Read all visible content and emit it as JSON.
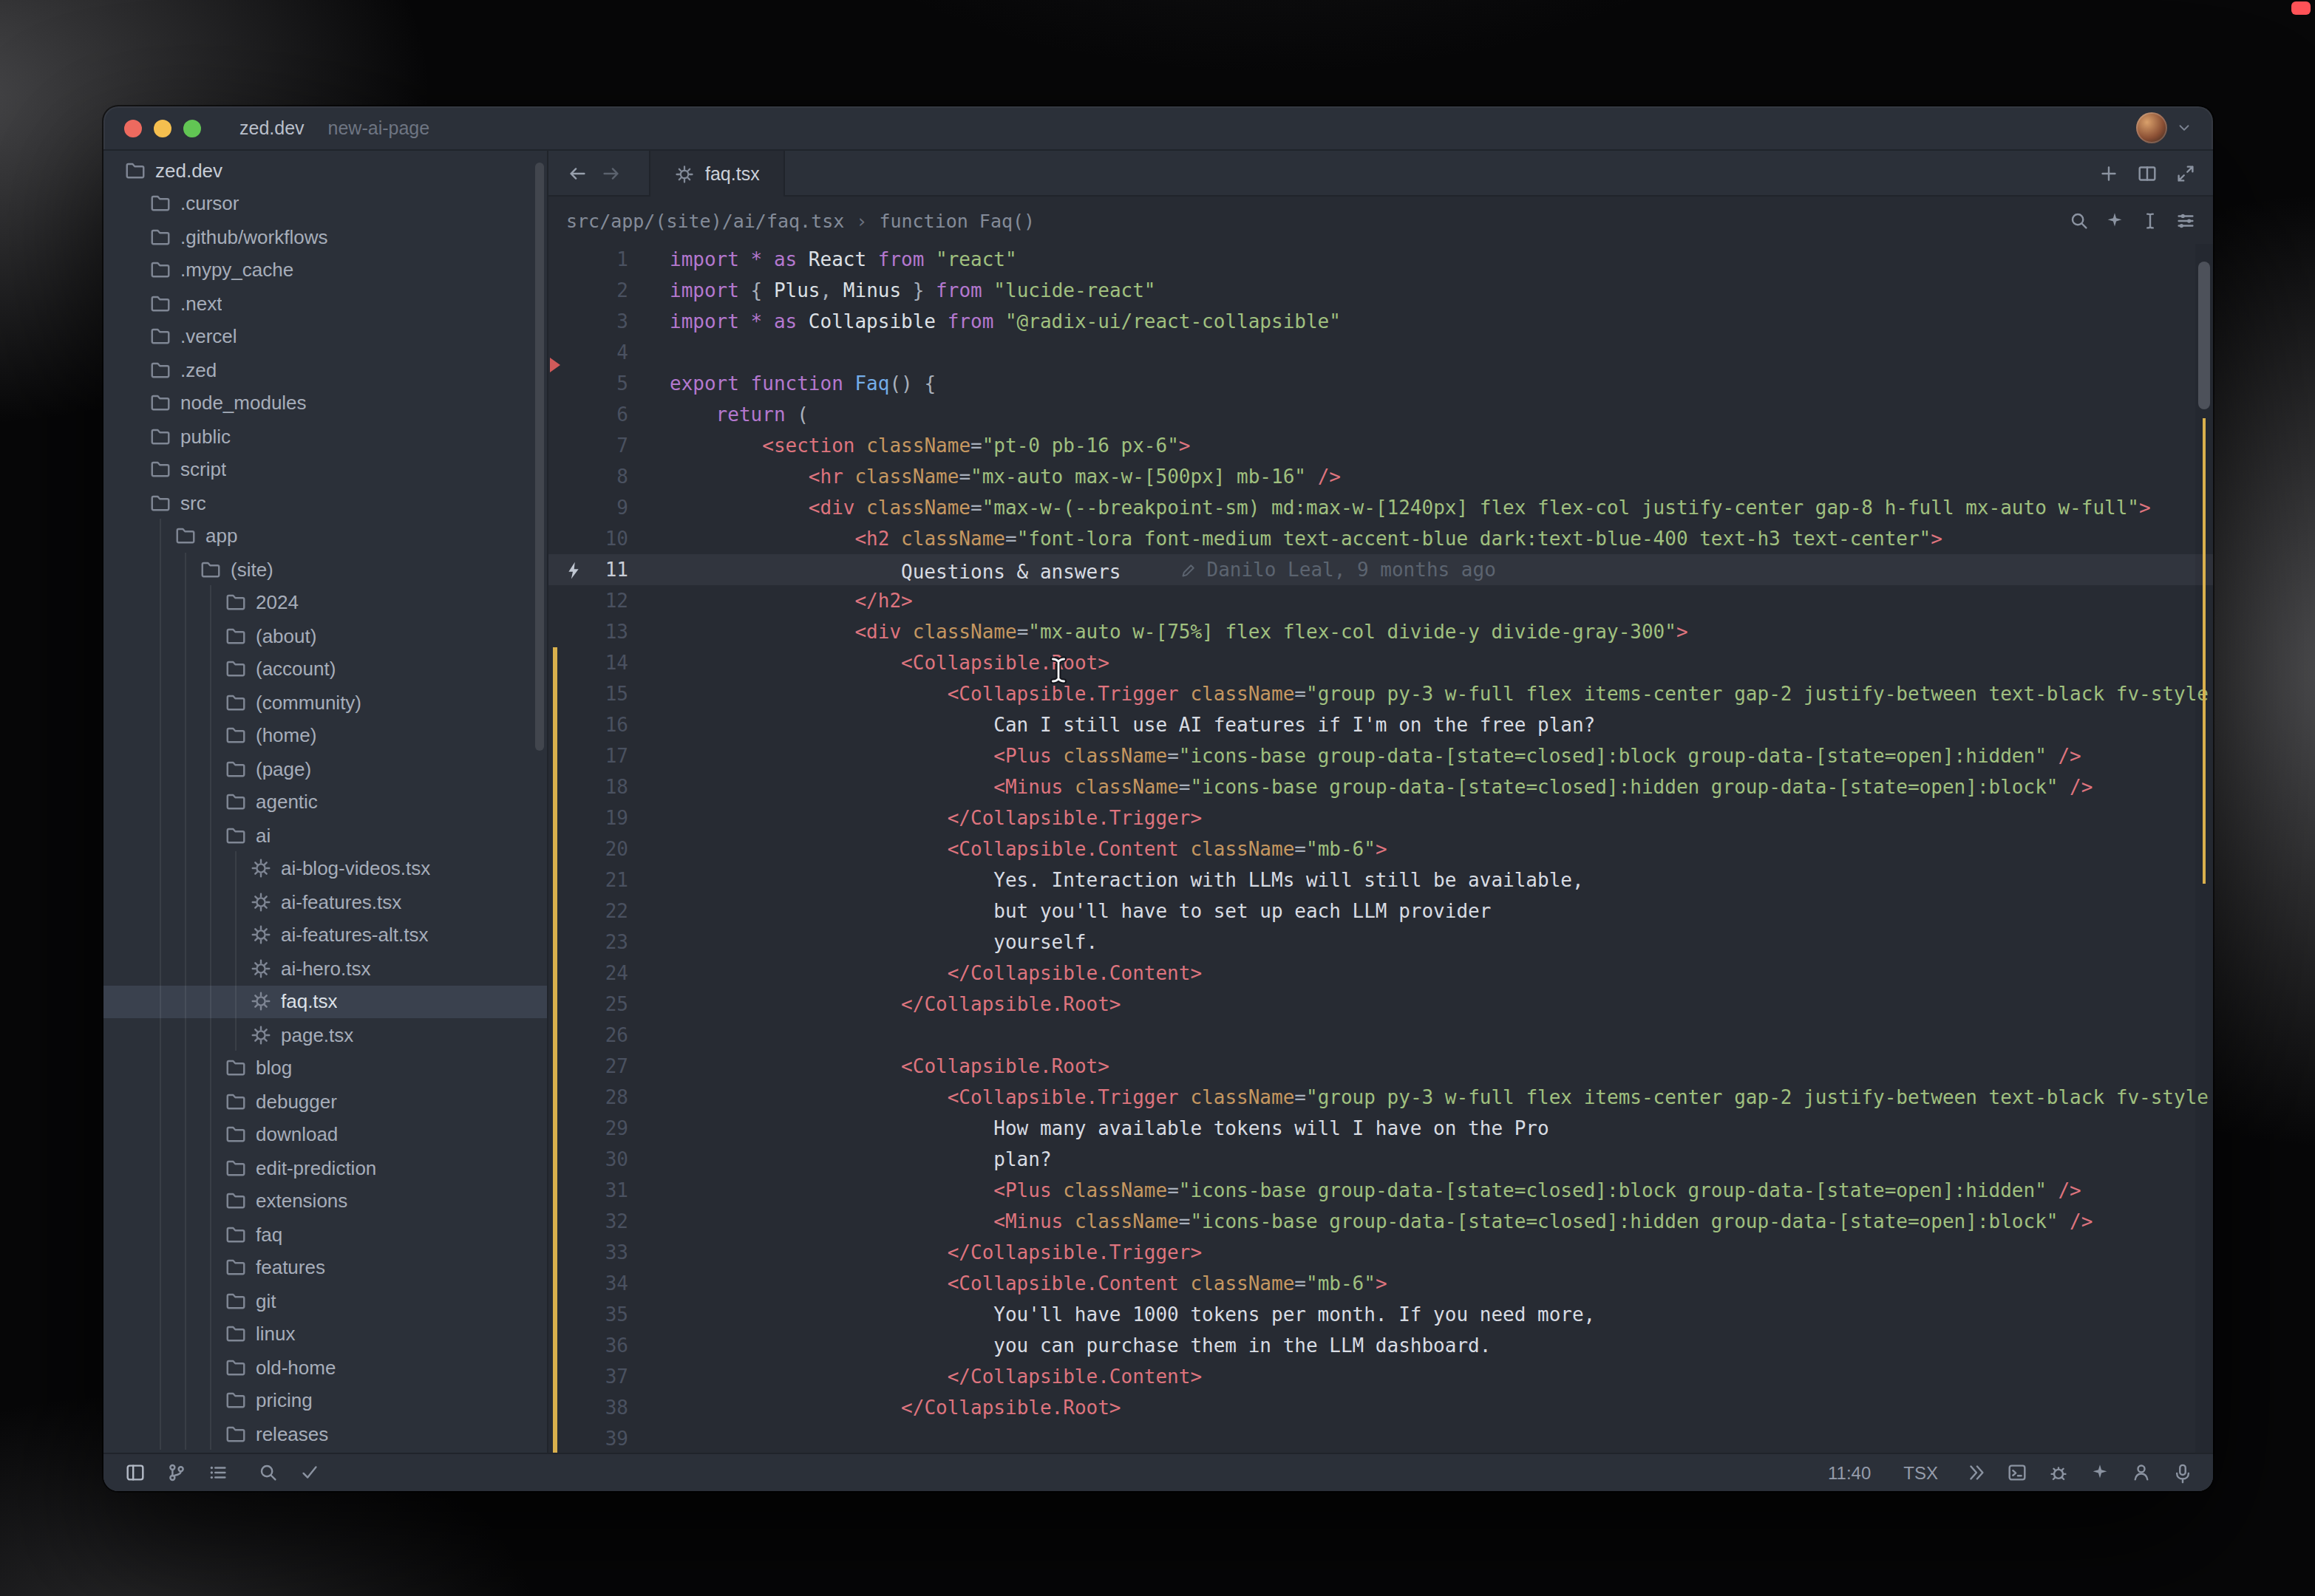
{
  "titlebar": {
    "project": "zed.dev",
    "branch": "new-ai-page"
  },
  "tab": {
    "label": "faq.tsx"
  },
  "breadcrumb": {
    "path": "src/app/(site)/ai/faq.tsx",
    "separator": "›",
    "symbol": "function Faq()"
  },
  "statusbar": {
    "cursor_position": "11:40",
    "language": "TSX"
  },
  "theme": {
    "window_bg": "#2b3039",
    "editor_bg": "#272b33",
    "selection_bg": "#3a414e",
    "traffic_red": "#ed6a5f",
    "traffic_yellow": "#f5bf4f",
    "traffic_green": "#62c554",
    "diff_modified": "#d9b04d",
    "diff_deleted": "#d15a5a"
  },
  "sidebar": {
    "items": [
      {
        "label": "zed.dev",
        "level": 0,
        "type": "folder",
        "root": true
      },
      {
        "label": ".cursor",
        "level": 1,
        "type": "folder"
      },
      {
        "label": ".github/workflows",
        "level": 1,
        "type": "folder"
      },
      {
        "label": ".mypy_cache",
        "level": 1,
        "type": "folder"
      },
      {
        "label": ".next",
        "level": 1,
        "type": "folder"
      },
      {
        "label": ".vercel",
        "level": 1,
        "type": "folder"
      },
      {
        "label": ".zed",
        "level": 1,
        "type": "folder"
      },
      {
        "label": "node_modules",
        "level": 1,
        "type": "folder"
      },
      {
        "label": "public",
        "level": 1,
        "type": "folder"
      },
      {
        "label": "script",
        "level": 1,
        "type": "folder"
      },
      {
        "label": "src",
        "level": 1,
        "type": "folder",
        "expanded": true
      },
      {
        "label": "app",
        "level": 2,
        "type": "folder",
        "expanded": true
      },
      {
        "label": "(site)",
        "level": 3,
        "type": "folder",
        "expanded": true
      },
      {
        "label": "2024",
        "level": 4,
        "type": "folder"
      },
      {
        "label": "(about)",
        "level": 4,
        "type": "folder"
      },
      {
        "label": "(account)",
        "level": 4,
        "type": "folder"
      },
      {
        "label": "(community)",
        "level": 4,
        "type": "folder"
      },
      {
        "label": "(home)",
        "level": 4,
        "type": "folder"
      },
      {
        "label": "(page)",
        "level": 4,
        "type": "folder"
      },
      {
        "label": "agentic",
        "level": 4,
        "type": "folder"
      },
      {
        "label": "ai",
        "level": 4,
        "type": "folder",
        "expanded": true
      },
      {
        "label": "ai-blog-videos.tsx",
        "level": 5,
        "type": "file"
      },
      {
        "label": "ai-features.tsx",
        "level": 5,
        "type": "file"
      },
      {
        "label": "ai-features-alt.tsx",
        "level": 5,
        "type": "file"
      },
      {
        "label": "ai-hero.tsx",
        "level": 5,
        "type": "file"
      },
      {
        "label": "faq.tsx",
        "level": 5,
        "type": "file",
        "selected": true
      },
      {
        "label": "page.tsx",
        "level": 5,
        "type": "file"
      },
      {
        "label": "blog",
        "level": 4,
        "type": "folder"
      },
      {
        "label": "debugger",
        "level": 4,
        "type": "folder"
      },
      {
        "label": "download",
        "level": 4,
        "type": "folder"
      },
      {
        "label": "edit-prediction",
        "level": 4,
        "type": "folder"
      },
      {
        "label": "extensions",
        "level": 4,
        "type": "folder"
      },
      {
        "label": "faq",
        "level": 4,
        "type": "folder"
      },
      {
        "label": "features",
        "level": 4,
        "type": "folder"
      },
      {
        "label": "git",
        "level": 4,
        "type": "folder"
      },
      {
        "label": "linux",
        "level": 4,
        "type": "folder"
      },
      {
        "label": "old-home",
        "level": 4,
        "type": "folder"
      },
      {
        "label": "pricing",
        "level": 4,
        "type": "folder"
      },
      {
        "label": "releases",
        "level": 4,
        "type": "folder"
      }
    ]
  },
  "editor": {
    "active_line": 11,
    "syntax": {
      "kw": "#b478cf",
      "pn": "#a8b0bc",
      "id": "#dce0e5",
      "st": "#a0c07f",
      "tg": "#de747e",
      "at": "#c59760",
      "fn": "#74ade8",
      "tx": "#d8dce3"
    },
    "lines": [
      {
        "n": 1,
        "t": [
          [
            "kw",
            "import * as"
          ],
          [
            "id",
            " React "
          ],
          [
            "kw",
            "from"
          ],
          [
            "st",
            " \"react\""
          ]
        ]
      },
      {
        "n": 2,
        "t": [
          [
            "kw",
            "import"
          ],
          [
            "pn",
            " { "
          ],
          [
            "id",
            "Plus"
          ],
          [
            "pn",
            ", "
          ],
          [
            "id",
            "Minus"
          ],
          [
            "pn",
            " } "
          ],
          [
            "kw",
            "from"
          ],
          [
            "st",
            " \"lucide-react\""
          ]
        ]
      },
      {
        "n": 3,
        "t": [
          [
            "kw",
            "import * as"
          ],
          [
            "id",
            " Collapsible "
          ],
          [
            "kw",
            "from"
          ],
          [
            "st",
            " \"@radix-ui/react-collapsible\""
          ]
        ]
      },
      {
        "n": 4,
        "t": []
      },
      {
        "n": 5,
        "t": [
          [
            "kw",
            "export function"
          ],
          [
            "fn",
            " Faq"
          ],
          [
            "pn",
            "() {"
          ]
        ]
      },
      {
        "n": 6,
        "t": [
          [
            "kw",
            "    return"
          ],
          [
            "pn",
            " ("
          ]
        ]
      },
      {
        "n": 7,
        "t": [
          [
            "pn",
            "        "
          ],
          [
            "tg",
            "<section"
          ],
          [
            "at",
            " className"
          ],
          [
            "pn",
            "="
          ],
          [
            "st",
            "\"pt-0 pb-16 px-6\""
          ],
          [
            "tg",
            ">"
          ]
        ]
      },
      {
        "n": 8,
        "t": [
          [
            "pn",
            "            "
          ],
          [
            "tg",
            "<hr"
          ],
          [
            "at",
            " className"
          ],
          [
            "pn",
            "="
          ],
          [
            "st",
            "\"mx-auto max-w-[500px] mb-16\""
          ],
          [
            "tg",
            " />"
          ]
        ]
      },
      {
        "n": 9,
        "t": [
          [
            "pn",
            "            "
          ],
          [
            "tg",
            "<div"
          ],
          [
            "at",
            " className"
          ],
          [
            "pn",
            "="
          ],
          [
            "st",
            "\"max-w-(--breakpoint-sm) md:max-w-[1240px] flex flex-col justify-center gap-8 h-full mx-auto w-full\""
          ],
          [
            "tg",
            ">"
          ]
        ]
      },
      {
        "n": 10,
        "t": [
          [
            "pn",
            "                "
          ],
          [
            "tg",
            "<h2"
          ],
          [
            "at",
            " className"
          ],
          [
            "pn",
            "="
          ],
          [
            "st",
            "\"font-lora font-medium text-accent-blue dark:text-blue-400 text-h3 text-center\""
          ],
          [
            "tg",
            ">"
          ]
        ]
      },
      {
        "n": 11,
        "t": [
          [
            "tx",
            "                    Questions & answers"
          ]
        ],
        "blame": "Danilo Leal, 9 months ago"
      },
      {
        "n": 12,
        "t": [
          [
            "pn",
            "                "
          ],
          [
            "tg",
            "</h2>"
          ]
        ]
      },
      {
        "n": 13,
        "t": [
          [
            "pn",
            "                "
          ],
          [
            "tg",
            "<div"
          ],
          [
            "at",
            " className"
          ],
          [
            "pn",
            "="
          ],
          [
            "st",
            "\"mx-auto w-[75%] flex flex-col divide-y divide-gray-300\""
          ],
          [
            "tg",
            ">"
          ]
        ]
      },
      {
        "n": 14,
        "t": [
          [
            "pn",
            "                    "
          ],
          [
            "tg",
            "<Collapsible.Root>"
          ]
        ]
      },
      {
        "n": 15,
        "t": [
          [
            "pn",
            "                        "
          ],
          [
            "tg",
            "<Collapsible.Trigger"
          ],
          [
            "at",
            " className"
          ],
          [
            "pn",
            "="
          ],
          [
            "st",
            "\"group py-3 w-full flex items-center gap-2 justify-between text-black fv-style"
          ]
        ]
      },
      {
        "n": 16,
        "t": [
          [
            "tx",
            "                            Can I still use AI features if I'm on the free plan?"
          ]
        ]
      },
      {
        "n": 17,
        "t": [
          [
            "pn",
            "                            "
          ],
          [
            "tg",
            "<Plus"
          ],
          [
            "at",
            " className"
          ],
          [
            "pn",
            "="
          ],
          [
            "st",
            "\"icons-base group-data-[state=closed]:block group-data-[state=open]:hidden\""
          ],
          [
            "tg",
            " />"
          ]
        ]
      },
      {
        "n": 18,
        "t": [
          [
            "pn",
            "                            "
          ],
          [
            "tg",
            "<Minus"
          ],
          [
            "at",
            " className"
          ],
          [
            "pn",
            "="
          ],
          [
            "st",
            "\"icons-base group-data-[state=closed]:hidden group-data-[state=open]:block\""
          ],
          [
            "tg",
            " />"
          ]
        ]
      },
      {
        "n": 19,
        "t": [
          [
            "pn",
            "                        "
          ],
          [
            "tg",
            "</Collapsible.Trigger>"
          ]
        ]
      },
      {
        "n": 20,
        "t": [
          [
            "pn",
            "                        "
          ],
          [
            "tg",
            "<Collapsible.Content"
          ],
          [
            "at",
            " className"
          ],
          [
            "pn",
            "="
          ],
          [
            "st",
            "\"mb-6\""
          ],
          [
            "tg",
            ">"
          ]
        ]
      },
      {
        "n": 21,
        "t": [
          [
            "tx",
            "                            Yes. Interaction with LLMs will still be available,"
          ]
        ]
      },
      {
        "n": 22,
        "t": [
          [
            "tx",
            "                            but you'll have to set up each LLM provider"
          ]
        ]
      },
      {
        "n": 23,
        "t": [
          [
            "tx",
            "                            yourself."
          ]
        ]
      },
      {
        "n": 24,
        "t": [
          [
            "pn",
            "                        "
          ],
          [
            "tg",
            "</Collapsible.Content>"
          ]
        ]
      },
      {
        "n": 25,
        "t": [
          [
            "pn",
            "                    "
          ],
          [
            "tg",
            "</Collapsible.Root>"
          ]
        ]
      },
      {
        "n": 26,
        "t": []
      },
      {
        "n": 27,
        "t": [
          [
            "pn",
            "                    "
          ],
          [
            "tg",
            "<Collapsible.Root>"
          ]
        ]
      },
      {
        "n": 28,
        "t": [
          [
            "pn",
            "                        "
          ],
          [
            "tg",
            "<Collapsible.Trigger"
          ],
          [
            "at",
            " className"
          ],
          [
            "pn",
            "="
          ],
          [
            "st",
            "\"group py-3 w-full flex items-center gap-2 justify-between text-black fv-style"
          ]
        ]
      },
      {
        "n": 29,
        "t": [
          [
            "tx",
            "                            How many available tokens will I have on the Pro"
          ]
        ]
      },
      {
        "n": 30,
        "t": [
          [
            "tx",
            "                            plan?"
          ]
        ]
      },
      {
        "n": 31,
        "t": [
          [
            "pn",
            "                            "
          ],
          [
            "tg",
            "<Plus"
          ],
          [
            "at",
            " className"
          ],
          [
            "pn",
            "="
          ],
          [
            "st",
            "\"icons-base group-data-[state=closed]:block group-data-[state=open]:hidden\""
          ],
          [
            "tg",
            " />"
          ]
        ]
      },
      {
        "n": 32,
        "t": [
          [
            "pn",
            "                            "
          ],
          [
            "tg",
            "<Minus"
          ],
          [
            "at",
            " className"
          ],
          [
            "pn",
            "="
          ],
          [
            "st",
            "\"icons-base group-data-[state=closed]:hidden group-data-[state=open]:block\""
          ],
          [
            "tg",
            " />"
          ]
        ]
      },
      {
        "n": 33,
        "t": [
          [
            "pn",
            "                        "
          ],
          [
            "tg",
            "</Collapsible.Trigger>"
          ]
        ]
      },
      {
        "n": 34,
        "t": [
          [
            "pn",
            "                        "
          ],
          [
            "tg",
            "<Collapsible.Content"
          ],
          [
            "at",
            " className"
          ],
          [
            "pn",
            "="
          ],
          [
            "st",
            "\"mb-6\""
          ],
          [
            "tg",
            ">"
          ]
        ]
      },
      {
        "n": 35,
        "t": [
          [
            "tx",
            "                            You'll have 1000 tokens per month. If you need more,"
          ]
        ]
      },
      {
        "n": 36,
        "t": [
          [
            "tx",
            "                            you can purchase them in the LLM dashboard."
          ]
        ]
      },
      {
        "n": 37,
        "t": [
          [
            "pn",
            "                        "
          ],
          [
            "tg",
            "</Collapsible.Content>"
          ]
        ]
      },
      {
        "n": 38,
        "t": [
          [
            "pn",
            "                    "
          ],
          [
            "tg",
            "</Collapsible.Root>"
          ]
        ]
      },
      {
        "n": 39,
        "t": []
      }
    ]
  }
}
